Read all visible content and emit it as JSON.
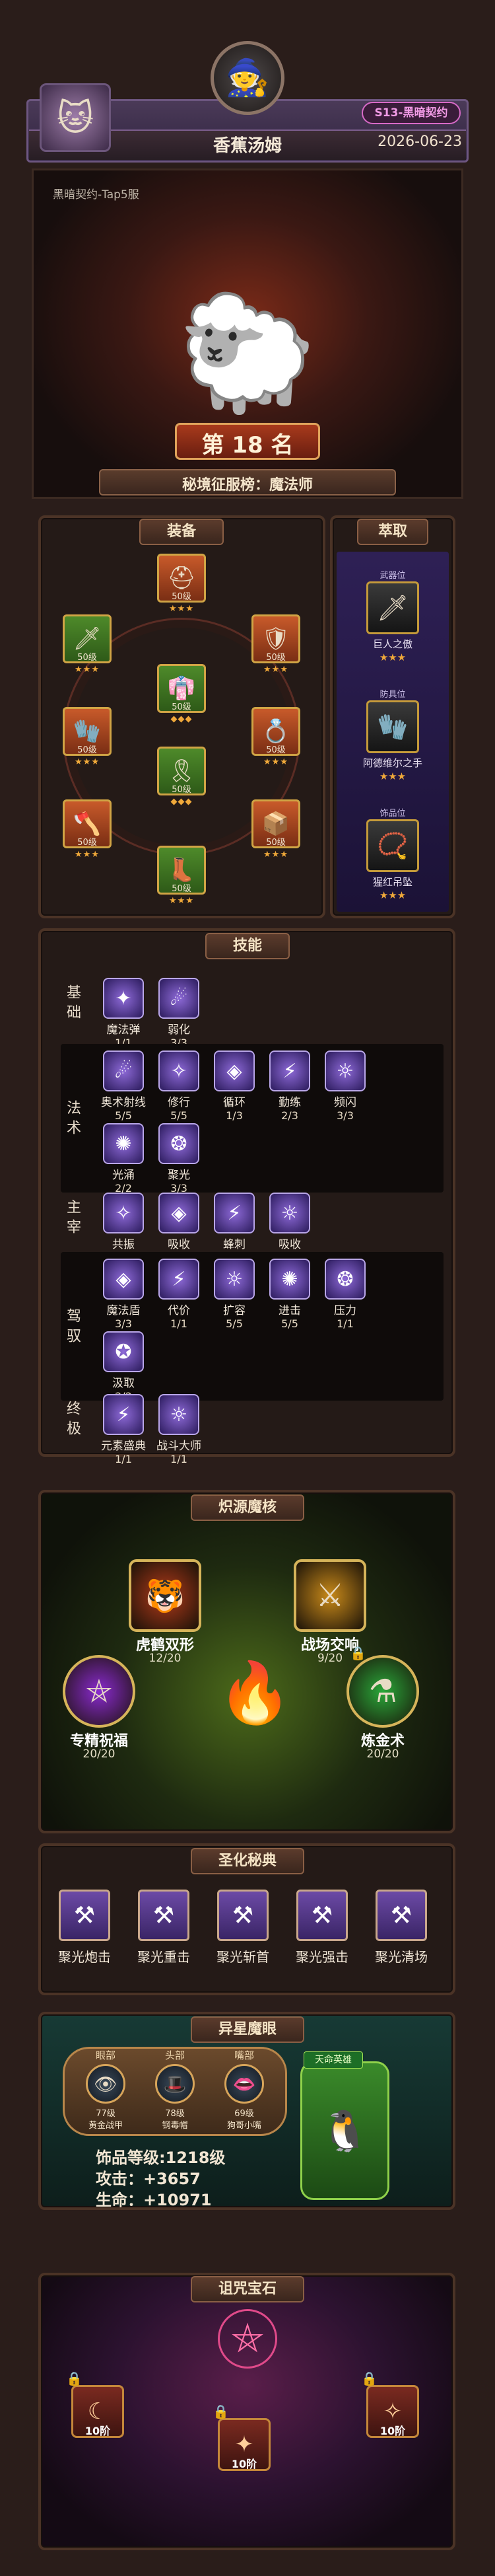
{
  "header": {
    "name": "香蕉汤姆",
    "season_badge": "S13-黑暗契约",
    "date": "2026-06-23"
  },
  "hero": {
    "server": "黑暗契约-Tap5服",
    "rank_text": "第 18 名",
    "rank_title": "秘境征服榜：魔法师"
  },
  "equipment": {
    "title": "装备",
    "items": [
      {
        "name": "helmet",
        "level": "50级",
        "stars": "★★★",
        "color": "orange",
        "icon": "⛑"
      },
      {
        "name": "left-weapon",
        "level": "50级",
        "stars": "★★★",
        "color": "green",
        "icon": "🗡"
      },
      {
        "name": "right-shoulder",
        "level": "50级",
        "stars": "★★★",
        "color": "orange",
        "icon": "🛡"
      },
      {
        "name": "armor",
        "level": "50级",
        "stars": "◆◆◆",
        "color": "green",
        "icon": "👘"
      },
      {
        "name": "gloves",
        "level": "50级",
        "stars": "★★★",
        "color": "orange",
        "icon": "🧤"
      },
      {
        "name": "ring",
        "level": "50级",
        "stars": "★★★",
        "color": "orange",
        "icon": "💍"
      },
      {
        "name": "belt",
        "level": "50级",
        "stars": "◆◆◆",
        "color": "green",
        "icon": "🎗"
      },
      {
        "name": "left-hand",
        "level": "50级",
        "stars": "★★★",
        "color": "orange",
        "icon": "🪓"
      },
      {
        "name": "right-hand",
        "level": "50级",
        "stars": "★★★",
        "color": "orange",
        "icon": "📦"
      },
      {
        "name": "boots",
        "level": "50级",
        "stars": "★★★",
        "color": "green",
        "icon": "👢"
      }
    ]
  },
  "extract": {
    "title": "萃取",
    "items": [
      {
        "tag": "武器位",
        "name": "巨人之傲",
        "stars": "★★★"
      },
      {
        "tag": "防具位",
        "name": "阿德维尔之手",
        "stars": "★★★"
      },
      {
        "tag": "饰品位",
        "name": "猩红吊坠",
        "stars": "★★★"
      }
    ]
  },
  "skills": {
    "title": "技能",
    "categories": [
      {
        "label": "基础",
        "items": [
          {
            "name": "魔法弹",
            "count": "1/1"
          },
          {
            "name": "弱化",
            "count": "3/3"
          }
        ]
      },
      {
        "label": "法术",
        "items": [
          {
            "name": "奥术射线",
            "count": "5/5"
          },
          {
            "name": "修行",
            "count": "5/5"
          },
          {
            "name": "循环",
            "count": "1/3"
          },
          {
            "name": "勤练",
            "count": "2/3"
          },
          {
            "name": "频闪",
            "count": "3/3"
          },
          {
            "name": "光涌",
            "count": "2/2"
          },
          {
            "name": "聚光",
            "count": "3/3"
          }
        ]
      },
      {
        "label": "主宰",
        "items": [
          {
            "name": "共振",
            "count": "1/1"
          },
          {
            "name": "吸收",
            "count": "1/1"
          },
          {
            "name": "蜂刺",
            "count": "3/3"
          },
          {
            "name": "吸收",
            "count": "1/3"
          }
        ]
      },
      {
        "label": "驾驭",
        "items": [
          {
            "name": "魔法盾",
            "count": "3/3"
          },
          {
            "name": "代价",
            "count": "1/1"
          },
          {
            "name": "扩容",
            "count": "5/5"
          },
          {
            "name": "进击",
            "count": "5/5"
          },
          {
            "name": "压力",
            "count": "1/1"
          },
          {
            "name": "汲取",
            "count": "2/2"
          }
        ]
      },
      {
        "label": "终极",
        "items": [
          {
            "name": "元素盛典",
            "count": "1/1"
          },
          {
            "name": "战斗大师",
            "count": "1/1"
          }
        ]
      }
    ]
  },
  "core": {
    "title": "炽源魔核",
    "items": [
      {
        "name": "虎鹤双形",
        "count": "12/20"
      },
      {
        "name": "战场交响",
        "count": "9/20"
      },
      {
        "name": "专精祝福",
        "count": "20/20"
      },
      {
        "name": "炼金术",
        "count": "20/20"
      }
    ]
  },
  "holy": {
    "title": "圣化秘典",
    "items": [
      {
        "name": "聚光炮击"
      },
      {
        "name": "聚光重击"
      },
      {
        "name": "聚光斩首"
      },
      {
        "name": "聚光强击"
      },
      {
        "name": "聚光清场"
      }
    ]
  },
  "eye": {
    "title": "异星魔眼",
    "slots": [
      {
        "tag": "眼部",
        "lv": "77级",
        "sub": "黄金战甲"
      },
      {
        "tag": "头部",
        "lv": "78级",
        "sub": "钢毒帽"
      },
      {
        "tag": "嘴部",
        "lv": "69级",
        "sub": "狗哥小嘴"
      }
    ],
    "badge": "天命英雄",
    "level_line": "饰品等级:1218级",
    "attack_line": "攻击：+3657",
    "life_line": "生命：+10971"
  },
  "gems": {
    "title": "诅咒宝石",
    "items": [
      {
        "label": "10阶"
      },
      {
        "label": "10阶"
      },
      {
        "label": "10阶"
      }
    ]
  }
}
